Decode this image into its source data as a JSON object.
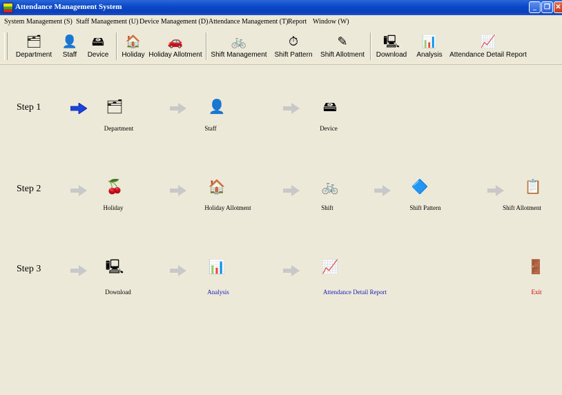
{
  "window": {
    "title": "Attendance Management System",
    "controls": {
      "minimize": "_",
      "restore": "❐",
      "close": "✕"
    }
  },
  "menu": [
    "System Management (S)",
    "Staff Management (U)",
    "Device Management (D)",
    "Attendance Management (T)",
    "Report",
    "Window (W)"
  ],
  "toolbar": [
    {
      "label": "Department",
      "icon": "department-icon",
      "glyph": "🗂"
    },
    {
      "label": "Staff",
      "icon": "staff-icon",
      "glyph": "👤"
    },
    {
      "label": "Device",
      "icon": "device-icon",
      "glyph": "🖴"
    },
    {
      "label": "Holiday",
      "icon": "holiday-icon",
      "glyph": "🏠"
    },
    {
      "label": "Holiday Allotment",
      "icon": "holiday-allotment-icon",
      "glyph": "🚗"
    },
    {
      "label": "Shift Management",
      "icon": "shift-management-icon",
      "glyph": "🚲"
    },
    {
      "label": "Shift Pattern",
      "icon": "shift-pattern-icon",
      "glyph": "⏱"
    },
    {
      "label": "Shift Allotment",
      "icon": "shift-allotment-icon",
      "glyph": "✎"
    },
    {
      "label": "Download",
      "icon": "download-icon",
      "glyph": "🖳"
    },
    {
      "label": "Analysis",
      "icon": "analysis-icon",
      "glyph": "📊"
    },
    {
      "label": "Attendance Detail Report",
      "icon": "attendance-detail-report-icon",
      "glyph": "📈"
    }
  ],
  "steps": [
    {
      "label": "Step 1",
      "items": [
        {
          "label": "Department",
          "icon": "department-icon",
          "glyph": "🗂",
          "style": "normal"
        },
        {
          "label": "Staff",
          "icon": "staff-icon",
          "glyph": "👤",
          "style": "normal"
        },
        {
          "label": "Device",
          "icon": "device-icon",
          "glyph": "🖴",
          "style": "normal"
        }
      ]
    },
    {
      "label": "Step 2",
      "items": [
        {
          "label": "Holiday",
          "icon": "holiday-icon",
          "glyph": "🍒",
          "style": "normal"
        },
        {
          "label": "Holiday Allotment",
          "icon": "holiday-allotment-icon",
          "glyph": "🏠",
          "style": "normal"
        },
        {
          "label": "Shift",
          "icon": "shift-icon",
          "glyph": "🚲",
          "style": "normal"
        },
        {
          "label": "Shift Pattern",
          "icon": "shift-pattern-icon",
          "glyph": "🔷",
          "style": "normal"
        },
        {
          "label": "Shift Allotment",
          "icon": "shift-allotment-icon",
          "glyph": "📋",
          "style": "normal"
        }
      ]
    },
    {
      "label": "Step 3",
      "items": [
        {
          "label": "Download",
          "icon": "download-icon",
          "glyph": "🖳",
          "style": "normal"
        },
        {
          "label": "Analysis",
          "icon": "analysis-icon",
          "glyph": "📊",
          "style": "blue"
        },
        {
          "label": "Attendance Detail Report",
          "icon": "attendance-detail-report-icon",
          "glyph": "📈",
          "style": "blue"
        },
        {
          "label": "Exit",
          "icon": "exit-icon",
          "glyph": "🚪",
          "style": "red"
        }
      ]
    }
  ],
  "colors": {
    "background": "#ECE9D8",
    "active_arrow": "#1a44e0",
    "inactive_arrow": "#c8c8c8",
    "link_blue": "#1a1ab8",
    "exit_red": "#cc0000"
  }
}
